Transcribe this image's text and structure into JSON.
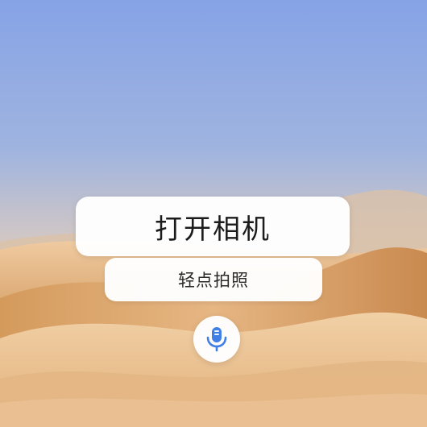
{
  "wallpaper": {
    "sky_top": "#8aa6e4",
    "sky_horizon": "#e0cdb8",
    "sand_light": "#e9c295",
    "sand_dark": "#c98e56"
  },
  "voice_card": {
    "command": "打开相机",
    "hint": "轻点拍照"
  },
  "mic_button": {
    "icon": "microphone-icon",
    "accent": "#3f7fe6"
  }
}
